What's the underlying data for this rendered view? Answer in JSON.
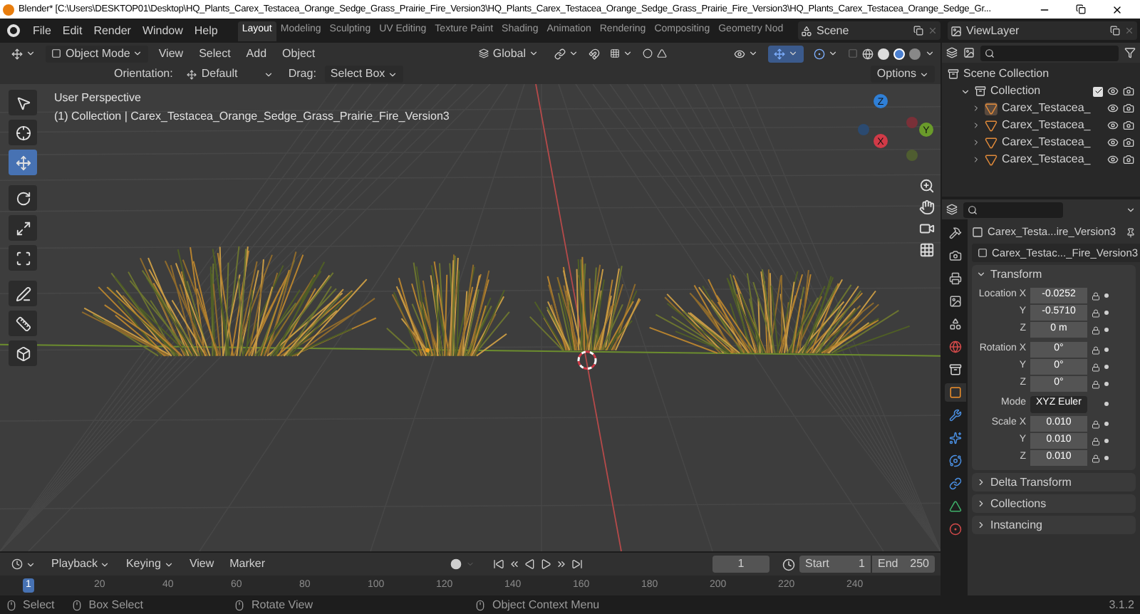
{
  "window": {
    "title": "Blender* [C:\\Users\\DESKTOP01\\Desktop\\HQ_Plants_Carex_Testacea_Orange_Sedge_Grass_Prairie_Fire_Version3\\HQ_Plants_Carex_Testacea_Orange_Sedge_Grass_Prairie_Fire_Version3\\HQ_Plants_Carex_Testacea_Orange_Sedge_Gr..."
  },
  "menu": [
    "File",
    "Edit",
    "Render",
    "Window",
    "Help"
  ],
  "workspaces": [
    {
      "label": "Layout",
      "selected": true
    },
    {
      "label": "Modeling",
      "selected": false
    },
    {
      "label": "Sculpting",
      "selected": false
    },
    {
      "label": "UV Editing",
      "selected": false
    },
    {
      "label": "Texture Paint",
      "selected": false
    },
    {
      "label": "Shading",
      "selected": false
    },
    {
      "label": "Animation",
      "selected": false
    },
    {
      "label": "Rendering",
      "selected": false
    },
    {
      "label": "Compositing",
      "selected": false
    },
    {
      "label": "Geometry Nod",
      "selected": false
    }
  ],
  "scene": "Scene",
  "view_layer": "ViewLayer",
  "viewport_header": {
    "mode": "Object Mode",
    "menus": [
      "View",
      "Select",
      "Add",
      "Object"
    ],
    "orientation": "Global"
  },
  "tool_settings": {
    "orientation_label": "Orientation:",
    "orientation": "Default",
    "drag_label": "Drag:",
    "drag": "Select Box",
    "options": "Options"
  },
  "viewport": {
    "view_name": "User Perspective",
    "object_info": "(1) Collection | Carex_Testacea_Orange_Sedge_Grass_Prairie_Fire_Version3"
  },
  "tools": [
    {
      "kind": "select",
      "selected": false
    },
    {
      "kind": "cursor",
      "selected": false
    },
    {
      "kind": "move",
      "selected": true
    },
    {
      "kind": "rotate",
      "selected": false
    },
    {
      "kind": "scale",
      "selected": false
    },
    {
      "kind": "transform",
      "selected": false
    },
    {
      "kind": "annotate",
      "selected": false
    },
    {
      "kind": "measure",
      "selected": false
    },
    {
      "kind": "add_cube",
      "selected": false
    }
  ],
  "gizmo_axes": [
    {
      "label": "Z",
      "color": "#2f7fd6"
    },
    {
      "label": "Y",
      "color": "#6a9b2a"
    },
    {
      "label": "X",
      "color": "#d13a47"
    }
  ],
  "outliner": {
    "label": "Scene Collection",
    "children": [
      {
        "label": "Collection",
        "expanded": true,
        "checked": true,
        "children": [
          {
            "label": "Carex_Testacea_",
            "expanded": false,
            "selected": true
          },
          {
            "label": "Carex_Testacea_",
            "expanded": false,
            "selected": false
          },
          {
            "label": "Carex_Testacea_",
            "expanded": false,
            "selected": false
          },
          {
            "label": "Carex_Testacea_",
            "expanded": false,
            "selected": false
          }
        ]
      }
    ]
  },
  "properties": {
    "tabs": [
      {
        "kind": "tool",
        "selected": false
      },
      {
        "kind": "render",
        "selected": false
      },
      {
        "kind": "output",
        "selected": false
      },
      {
        "kind": "view_layer",
        "selected": false
      },
      {
        "kind": "scene",
        "selected": false
      },
      {
        "kind": "world",
        "selected": false
      },
      {
        "kind": "collection",
        "selected": false
      },
      {
        "kind": "object",
        "selected": true
      },
      {
        "kind": "modifiers",
        "selected": false
      },
      {
        "kind": "particles",
        "selected": false
      },
      {
        "kind": "physics",
        "selected": false
      },
      {
        "kind": "constraints",
        "selected": false
      },
      {
        "kind": "data",
        "selected": false
      },
      {
        "kind": "material",
        "selected": false
      }
    ],
    "object_name": "Carex_Testa...ire_Version3",
    "data_name": "Carex_Testac..._Fire_Version3",
    "transform": {
      "title": "Transform",
      "expanded": true,
      "groups": [
        [
          {
            "label": "Location X",
            "value": "-0.0252",
            "kind": "number"
          },
          {
            "label": "Y",
            "value": "-0.5710",
            "kind": "number"
          },
          {
            "label": "Z",
            "value": "0 m",
            "kind": "number"
          }
        ],
        [
          {
            "label": "Rotation X",
            "value": "0°",
            "kind": "number"
          },
          {
            "label": "Y",
            "value": "0°",
            "kind": "number"
          },
          {
            "label": "Z",
            "value": "0°",
            "kind": "number"
          }
        ],
        [
          {
            "label": "Mode",
            "value": "XYZ Euler",
            "kind": "dropdown"
          }
        ],
        [
          {
            "label": "Scale X",
            "value": "0.010",
            "kind": "number"
          },
          {
            "label": "Y",
            "value": "0.010",
            "kind": "number"
          },
          {
            "label": "Z",
            "value": "0.010",
            "kind": "number"
          }
        ]
      ]
    },
    "panels": [
      {
        "title": "Delta Transform",
        "expanded": false
      },
      {
        "title": "Collections",
        "expanded": false
      },
      {
        "title": "Instancing",
        "expanded": false
      }
    ]
  },
  "timeline": {
    "menus": [
      "Playback",
      "Keying",
      "View",
      "Marker"
    ],
    "current_frame": "1",
    "start_label": "Start",
    "start": "1",
    "end_label": "End",
    "end": "250",
    "ruler": [
      {
        "label": "1",
        "selected": true
      },
      {
        "label": "20",
        "selected": false
      },
      {
        "label": "40",
        "selected": false
      },
      {
        "label": "60",
        "selected": false
      },
      {
        "label": "80",
        "selected": false
      },
      {
        "label": "100",
        "selected": false
      },
      {
        "label": "120",
        "selected": false
      },
      {
        "label": "140",
        "selected": false
      },
      {
        "label": "160",
        "selected": false
      },
      {
        "label": "180",
        "selected": false
      },
      {
        "label": "200",
        "selected": false
      },
      {
        "label": "220",
        "selected": false
      },
      {
        "label": "240",
        "selected": false
      }
    ]
  },
  "status_bar": {
    "hints": [
      {
        "kind": "left",
        "label": "Select"
      },
      {
        "kind": "drag",
        "label": "Box Select"
      },
      {
        "kind": "middle",
        "label": "Rotate View"
      },
      {
        "kind": "right",
        "label": "Object Context Menu"
      }
    ],
    "version": "3.1.2"
  }
}
